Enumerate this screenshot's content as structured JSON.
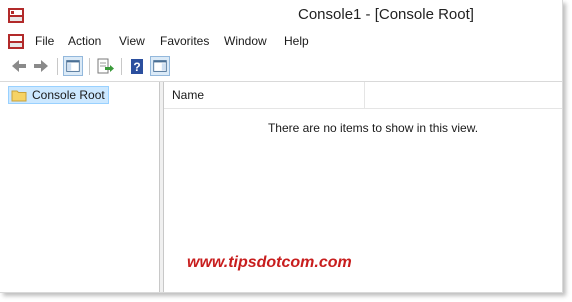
{
  "window": {
    "title": "Console1 - [Console Root]"
  },
  "menu": [
    "File",
    "Action",
    "View",
    "Favorites",
    "Window",
    "Help"
  ],
  "toolbar": {
    "buttons": [
      "back-icon",
      "forward-icon",
      "show-hide-tree-icon",
      "export-list-icon",
      "help-icon",
      "show-hide-action-pane-icon"
    ]
  },
  "tree": {
    "root_label": "Console Root"
  },
  "list": {
    "columns": [
      "Name"
    ],
    "empty_message": "There are no items to show in this view."
  },
  "watermark": "www.tipsdotcom.com",
  "colors": {
    "accent_selection": "#cce8ff",
    "watermark": "#c81e1e",
    "folder": "#f6d365"
  }
}
